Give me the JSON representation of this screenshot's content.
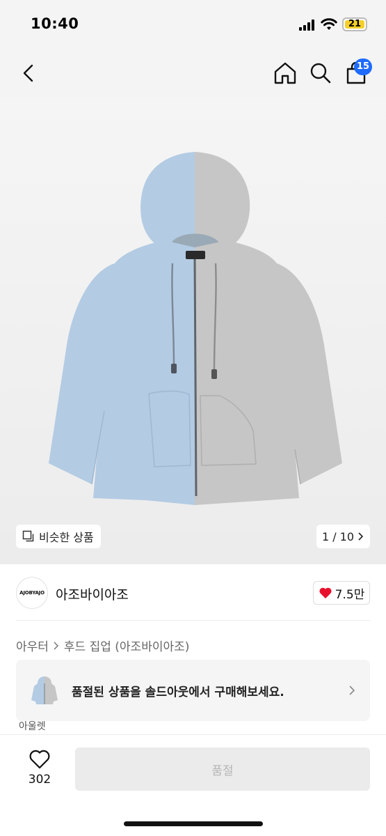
{
  "status_bar": {
    "time": "10:40",
    "battery": "21"
  },
  "nav": {
    "cart_count": "15"
  },
  "gallery": {
    "similar_label": "비슷한 상품",
    "pager": "1 / 10"
  },
  "brand": {
    "logo_text": "AJOBYAJO",
    "name": "아조바이아조",
    "likes": "7.5만"
  },
  "breadcrumb": {
    "category": "아우터",
    "subcategory": "후드 집업 (아조바이아조)"
  },
  "soldout_banner": {
    "text": "품절된 상품을 솔드아웃에서 구매해보세요."
  },
  "outlet": {
    "label": "아울렛"
  },
  "bottom_bar": {
    "wish_count": "302",
    "buy_label": "품절"
  },
  "colors": {
    "accent_blue": "#1f6bff",
    "heart_red": "#e8112d",
    "hoodie_blue": "#b3cbe3",
    "hoodie_gray": "#c6c6c6"
  }
}
